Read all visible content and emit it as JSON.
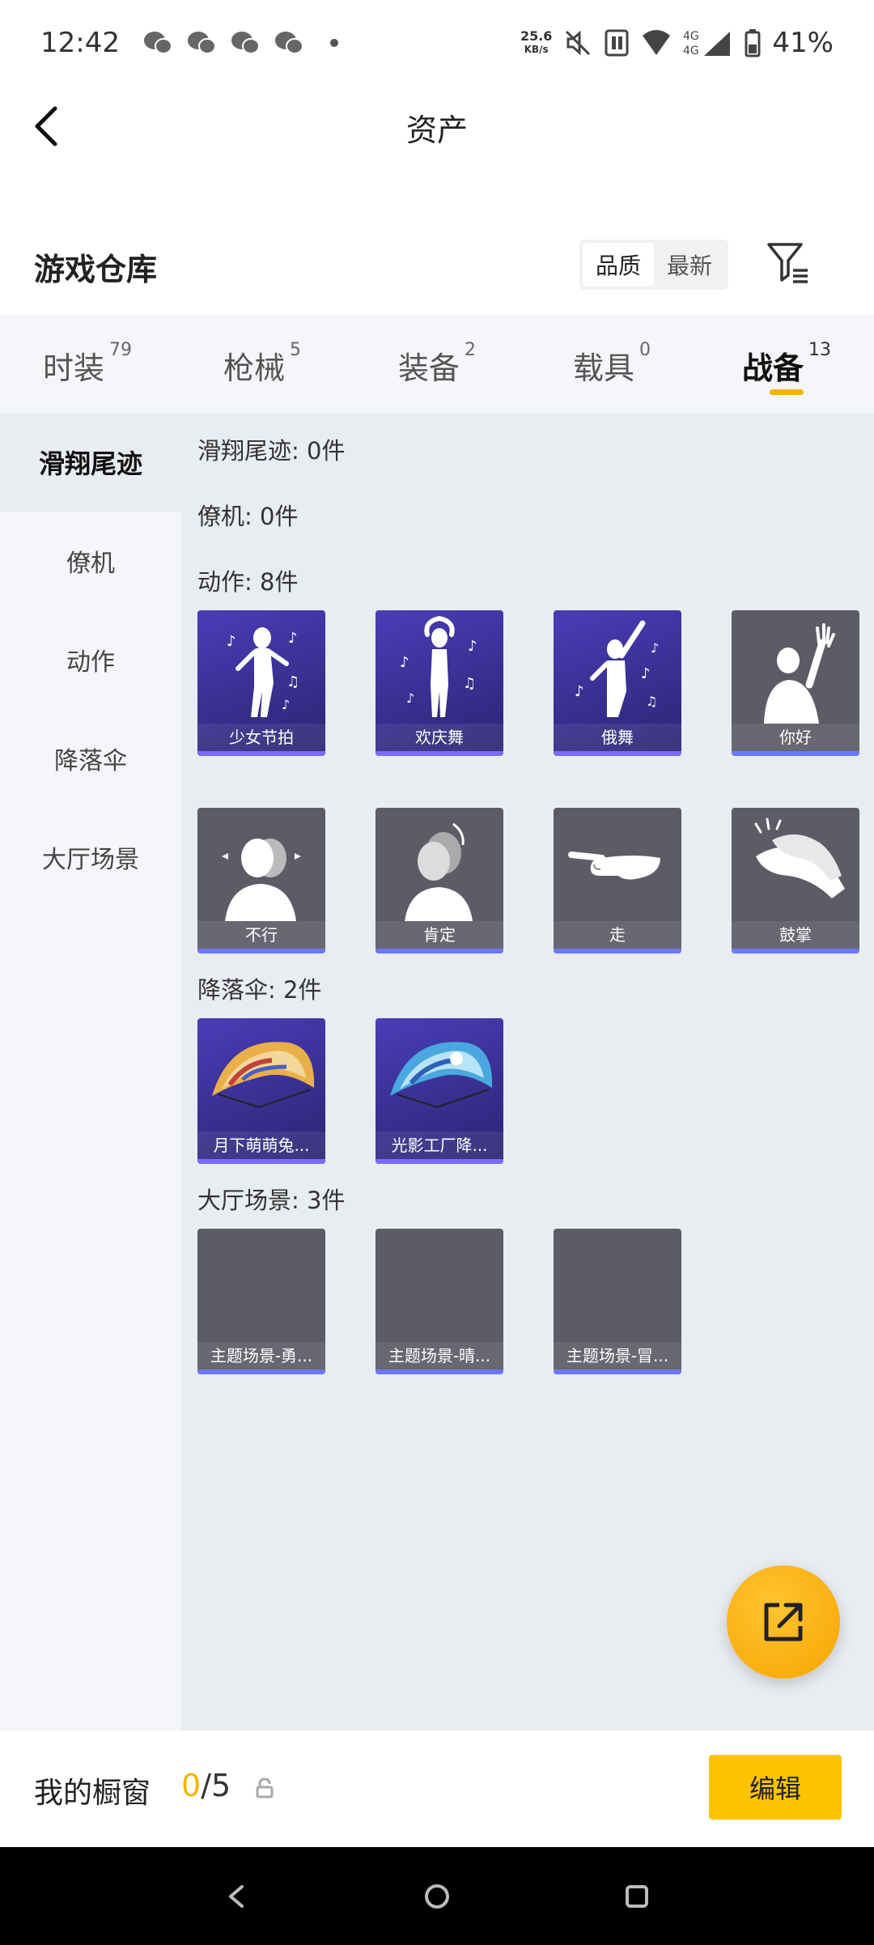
{
  "status": {
    "time": "12:42",
    "speed_value": "25.6",
    "speed_unit": "KB/s",
    "battery": "41%"
  },
  "header": {
    "title": "资产",
    "section_title": "游戏仓库",
    "sort_quality": "品质",
    "sort_newest": "最新"
  },
  "tabs": [
    {
      "label": "时装",
      "count": "79"
    },
    {
      "label": "枪械",
      "count": "5"
    },
    {
      "label": "装备",
      "count": "2"
    },
    {
      "label": "载具",
      "count": "0"
    },
    {
      "label": "战备",
      "count": "13"
    }
  ],
  "sidebar": [
    {
      "label": "滑翔尾迹"
    },
    {
      "label": "僚机"
    },
    {
      "label": "动作"
    },
    {
      "label": "降落伞"
    },
    {
      "label": "大厅场景"
    }
  ],
  "categories": [
    {
      "title": "滑翔尾迹: 0件"
    },
    {
      "title": "僚机: 0件"
    },
    {
      "title": "动作: 8件"
    },
    {
      "title": "降落伞: 2件"
    },
    {
      "title": "大厅场景: 3件"
    }
  ],
  "emotes": [
    {
      "label": "少女节拍",
      "icon": "dancer-girl-icon"
    },
    {
      "label": "欢庆舞",
      "icon": "celebration-dance-icon"
    },
    {
      "label": "俄舞",
      "icon": "russian-dance-icon"
    },
    {
      "label": "你好",
      "icon": "wave-hello-icon"
    },
    {
      "label": "不行",
      "icon": "head-shake-icon"
    },
    {
      "label": "肯定",
      "icon": "head-nod-icon"
    },
    {
      "label": "走",
      "icon": "pointing-hand-icon"
    },
    {
      "label": "鼓掌",
      "icon": "clapping-icon"
    }
  ],
  "parachutes": [
    {
      "label": "月下萌萌兔..."
    },
    {
      "label": "光影工厂降..."
    }
  ],
  "scenes": [
    {
      "label": "主题场景-勇..."
    },
    {
      "label": "主题场景-晴..."
    },
    {
      "label": "主题场景-冒..."
    }
  ],
  "bottom": {
    "window_label": "我的橱窗",
    "current": "0",
    "total": "/5",
    "edit_label": "编辑"
  },
  "colors": {
    "accent": "#f5b400",
    "card_purple": "#3a2f9c",
    "card_gray": "#5b5c65"
  }
}
